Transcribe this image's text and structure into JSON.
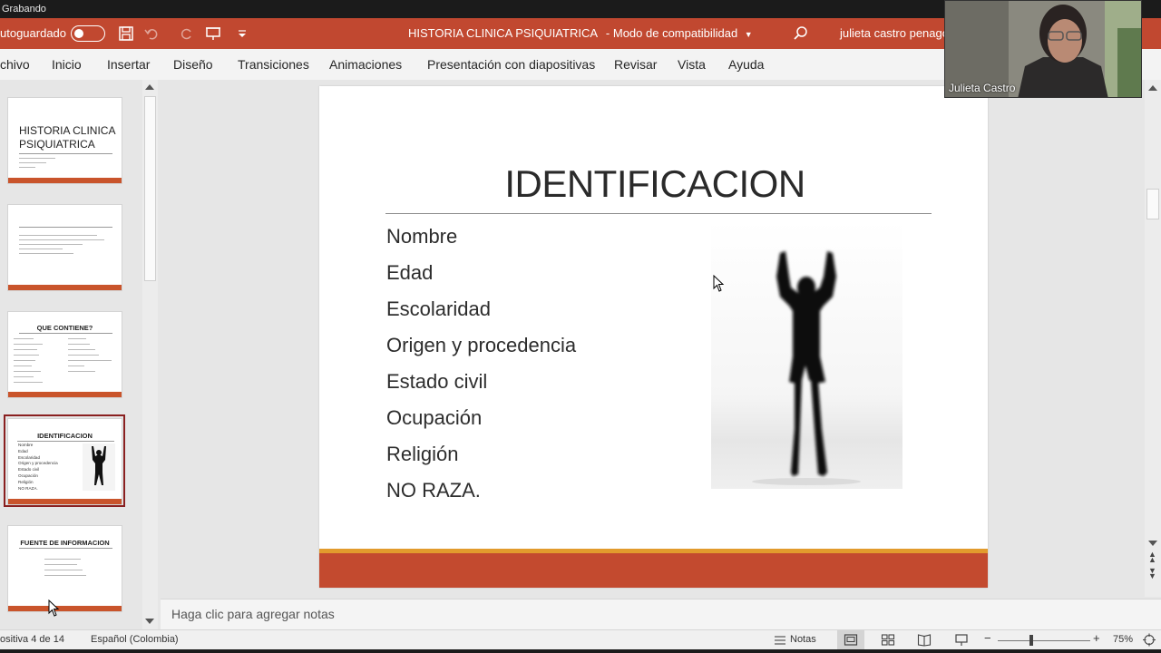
{
  "recording": {
    "label": "Grabando"
  },
  "titlebar": {
    "autosave_label": "utoguardado",
    "document_title": "HISTORIA CLINICA PSIQUIATRICA",
    "mode": "-  Modo de compatibilidad",
    "user": "julieta castro penago:"
  },
  "ribbon": {
    "tabs": [
      "chivo",
      "Inicio",
      "Insertar",
      "Diseño",
      "Transiciones",
      "Animaciones",
      "Presentación con diapositivas",
      "Revisar",
      "Vista",
      "Ayuda"
    ]
  },
  "thumbnails": {
    "items": [
      {
        "title_line1": "HISTORIA CLINICA",
        "title_line2": "PSIQUIATRICA"
      },
      {
        "title_line1": "",
        "title_line2": ""
      },
      {
        "title_line1": "QUE CONTIENE?",
        "title_line2": ""
      },
      {
        "title_line1": "IDENTIFICACION",
        "title_line2": "",
        "bullets": [
          "Nombre",
          "Edad",
          "Escolaridad",
          "Origen y procedencia",
          "Estado civil",
          "Ocupación",
          "Religión",
          "NO RAZA."
        ]
      },
      {
        "title_line1": "FUENTE DE INFORMACION",
        "title_line2": ""
      }
    ],
    "selected_index": 3
  },
  "slide": {
    "title": "IDENTIFICACION",
    "bullets": [
      "Nombre",
      "Edad",
      "Escolaridad",
      "Origen y procedencia",
      "Estado civil",
      "Ocupación",
      "Religión",
      "NO RAZA."
    ],
    "image": "silhouette-person-arms-raised"
  },
  "notes": {
    "placeholder": "Haga clic para agregar notas"
  },
  "status": {
    "slide_counter": "ositiva 4 de 14",
    "language": "Español (Colombia)",
    "notes_label": "Notas",
    "zoom_percent": "75%",
    "zoom_minus": "−",
    "zoom_plus": "+"
  },
  "webcam": {
    "name": "Julieta Castro"
  },
  "colors": {
    "title_bar": "#c14830",
    "accent_orange": "#e29b2d",
    "selection": "#8a2020"
  }
}
